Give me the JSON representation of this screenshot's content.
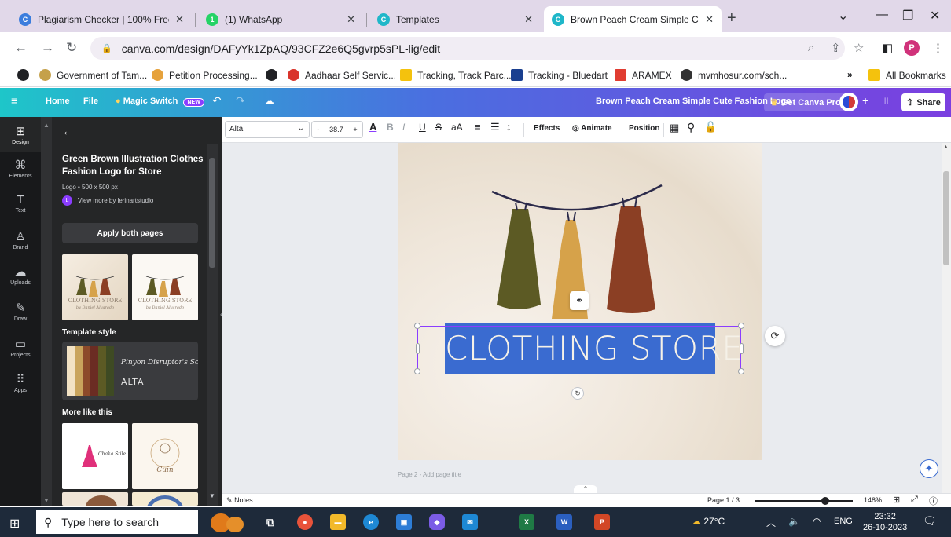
{
  "browser": {
    "tabs": [
      {
        "title": "Plagiarism Checker | 100% Free",
        "icon": "plagiarism-favicon",
        "color": "#3b7ddd"
      },
      {
        "title": "(1) WhatsApp",
        "icon": "whatsapp-favicon",
        "color": "#25d366"
      },
      {
        "title": "Templates",
        "icon": "canva-favicon",
        "color": "#1fb7c9"
      },
      {
        "title": "Brown Peach Cream Simple Cute",
        "icon": "canva-favicon",
        "color": "#1fb7c9",
        "active": true
      }
    ],
    "url": "canva.com/design/DAFyYk1ZpAQ/93CFZ2e6Q5gvrp5sPL-lig/edit",
    "profile_initial": "P",
    "bookmarks": [
      {
        "label": "Government of Tam...",
        "color": "#c5a14a"
      },
      {
        "label": "Petition Processing...",
        "color": "#e6a23c"
      },
      {
        "label": "Aadhaar Self Servic...",
        "color": "#d9342b"
      },
      {
        "label": "Tracking, Track Parc...",
        "color": "#f4c20d"
      },
      {
        "label": "Tracking - Bluedart",
        "color": "#1a3f8f"
      },
      {
        "label": "ARAMEX",
        "color": "#e03c31"
      },
      {
        "label": "mvmhosur.com/sch...",
        "color": "#333333"
      }
    ],
    "all_bookmarks": "All Bookmarks",
    "more_bookmarks": "»"
  },
  "canva_bar": {
    "home": "Home",
    "file": "File",
    "magic_switch": "Magic Switch",
    "new_badge": "NEW",
    "doc_title": "Brown Peach Cream Simple Cute Fashion Logo",
    "get_pro": "Get Canva Pro",
    "share": "Share"
  },
  "rail": [
    {
      "label": "Design",
      "icon": "design-icon",
      "glyph": "⊞"
    },
    {
      "label": "Elements",
      "icon": "elements-icon",
      "glyph": "⌘"
    },
    {
      "label": "Text",
      "icon": "text-icon",
      "glyph": "T"
    },
    {
      "label": "Brand",
      "icon": "brand-icon",
      "glyph": "♙"
    },
    {
      "label": "Uploads",
      "icon": "uploads-icon",
      "glyph": "☁"
    },
    {
      "label": "Draw",
      "icon": "draw-icon",
      "glyph": "✎"
    },
    {
      "label": "Projects",
      "icon": "projects-icon",
      "glyph": "▭"
    },
    {
      "label": "Apps",
      "icon": "apps-icon",
      "glyph": "⠿"
    }
  ],
  "panel": {
    "title": "Green Brown Illustration Clothes Fashion Logo for Store",
    "meta": "Logo • 500 x 500 px",
    "author_initial": "L",
    "author": "View more by lerinartstudio",
    "apply_button": "Apply both pages",
    "thumb_caption": "CLOTHING STORE",
    "thumb_sub": "by Daniel Alvarado",
    "template_style_label": "Template style",
    "style_font_script": "Pinyon Disruptor's Sc",
    "style_font_sans": "ALTA",
    "style_colors": [
      "#f2e2c4",
      "#c9a45c",
      "#8c4a2a",
      "#6b2c23",
      "#5c5a24",
      "#3e4a23"
    ],
    "more_like_this": "More like this",
    "more_thumb1_text": "Chaka Stile",
    "more_thumb2_text": "Cuin"
  },
  "toolbar": {
    "font": "Alta",
    "size": "38.7",
    "minus": "-",
    "plus": "+",
    "effects": "Effects",
    "animate": "Animate",
    "position": "Position"
  },
  "canvas": {
    "headline": "CLOTHING STORE",
    "next_page_label": "Page 2 - Add page title",
    "dress_colors": [
      "#5c5a24",
      "#d6a24a",
      "#8b3f24"
    ]
  },
  "footer": {
    "notes": "Notes",
    "page": "Page 1 / 3",
    "zoom": "148%",
    "zoom_fraction": 0.72
  },
  "taskbar": {
    "search_placeholder": "Type here to search",
    "temperature": "27°C",
    "language": "ENG",
    "time": "23:32",
    "date": "26-10-2023"
  }
}
